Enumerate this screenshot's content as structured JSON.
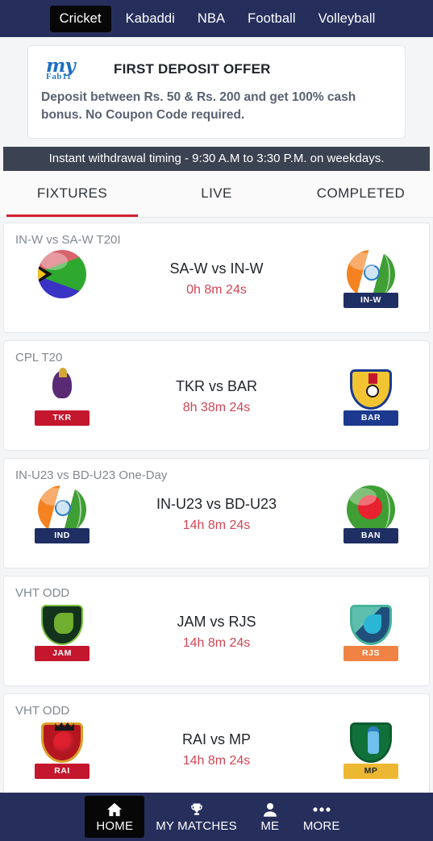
{
  "topnav": {
    "items": [
      {
        "label": "Cricket",
        "active": true
      },
      {
        "label": "Kabaddi",
        "active": false
      },
      {
        "label": "NBA",
        "active": false
      },
      {
        "label": "Football",
        "active": false
      },
      {
        "label": "Volleyball",
        "active": false
      }
    ]
  },
  "promo": {
    "logo_primary": "my",
    "logo_secondary": "Fab11",
    "title": "FIRST DEPOSIT OFFER",
    "body": "Deposit between Rs. 50 & Rs. 200 and get 100% cash bonus. No Coupon Code required."
  },
  "ticker": {
    "text": "Instant withdrawal timing - 9:30 A.M to 3:30 P.M. on weekdays."
  },
  "tabs": [
    {
      "label": "FIXTURES",
      "active": true
    },
    {
      "label": "LIVE",
      "active": false
    },
    {
      "label": "COMPLETED",
      "active": false
    }
  ],
  "matches": [
    {
      "series": "IN-W vs SA-W T20I",
      "teams": "SA-W vs IN-W",
      "countdown": "0h 8m 24s",
      "home": {
        "code": "SA-W",
        "icon": "south-africa-flag-badge"
      },
      "away": {
        "code": "IN-W",
        "icon": "india-cricket-ball-badge"
      }
    },
    {
      "series": "CPL T20",
      "teams": "TKR vs BAR",
      "countdown": "8h 38m 24s",
      "home": {
        "code": "TKR",
        "icon": "trinbago-knight-riders-badge"
      },
      "away": {
        "code": "BAR",
        "icon": "barbados-royals-badge"
      }
    },
    {
      "series": "IN-U23 vs BD-U23 One-Day",
      "teams": "IN-U23 vs BD-U23",
      "countdown": "14h 8m 24s",
      "home": {
        "code": "IND",
        "icon": "india-cricket-ball-badge"
      },
      "away": {
        "code": "BAN",
        "icon": "bangladesh-cricket-ball-badge"
      }
    },
    {
      "series": "VHT ODD",
      "teams": "JAM vs RJS",
      "countdown": "14h 8m 24s",
      "home": {
        "code": "JAM",
        "icon": "jammu-badge"
      },
      "away": {
        "code": "RJS",
        "icon": "rajasthan-bird-badge"
      }
    },
    {
      "series": "VHT ODD",
      "teams": "RAI vs MP",
      "countdown": "14h 8m 24s",
      "home": {
        "code": "RAI",
        "icon": "railways-badge"
      },
      "away": {
        "code": "MP",
        "icon": "madhya-pradesh-badge"
      }
    }
  ],
  "bottomnav": [
    {
      "label": "HOME",
      "icon": "home-icon",
      "active": true
    },
    {
      "label": "MY MATCHES",
      "icon": "trophy-icon",
      "active": false
    },
    {
      "label": "ME",
      "icon": "person-icon",
      "active": false
    },
    {
      "label": "MORE",
      "icon": "ellipsis-icon",
      "active": false
    }
  ],
  "colors": {
    "navy": "#262f5c",
    "accent_red": "#d22030",
    "countdown_red": "#cf4655",
    "ticker_bg": "#3b4251",
    "page_bg": "#f4f5f7"
  }
}
